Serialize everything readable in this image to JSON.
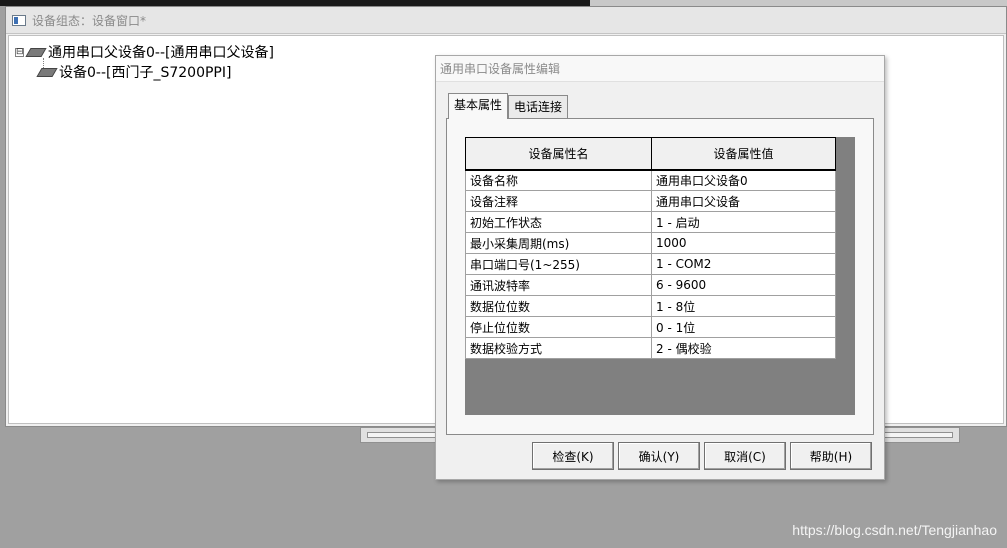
{
  "main_window": {
    "title": "设备组态：设备窗口*",
    "tree": {
      "root": "通用串口父设备0--[通用串口父设备]",
      "child": "设备0--[西门子_S7200PPI]",
      "expander": "⊟"
    }
  },
  "dialog": {
    "title": "通用串口设备属性编辑",
    "tabs": [
      {
        "label": "基本属性",
        "active": true
      },
      {
        "label": "电话连接",
        "active": false
      }
    ],
    "table": {
      "headers": [
        "设备属性名",
        "设备属性值"
      ],
      "rows": [
        [
          "设备名称",
          "通用串口父设备0"
        ],
        [
          "设备注释",
          "通用串口父设备"
        ],
        [
          "初始工作状态",
          "1 - 启动"
        ],
        [
          "最小采集周期(ms)",
          "1000"
        ],
        [
          "串口端口号(1~255)",
          "1 - COM2"
        ],
        [
          "通讯波特率",
          "6 - 9600"
        ],
        [
          "数据位位数",
          "1 - 8位"
        ],
        [
          "停止位位数",
          "0 - 1位"
        ],
        [
          "数据校验方式",
          "2 - 偶校验"
        ]
      ]
    },
    "buttons": {
      "check": "检查(K)",
      "confirm": "确认(Y)",
      "cancel": "取消(C)",
      "help": "帮助(H)"
    }
  },
  "watermark": "https://blog.csdn.net/Tengjianhao"
}
